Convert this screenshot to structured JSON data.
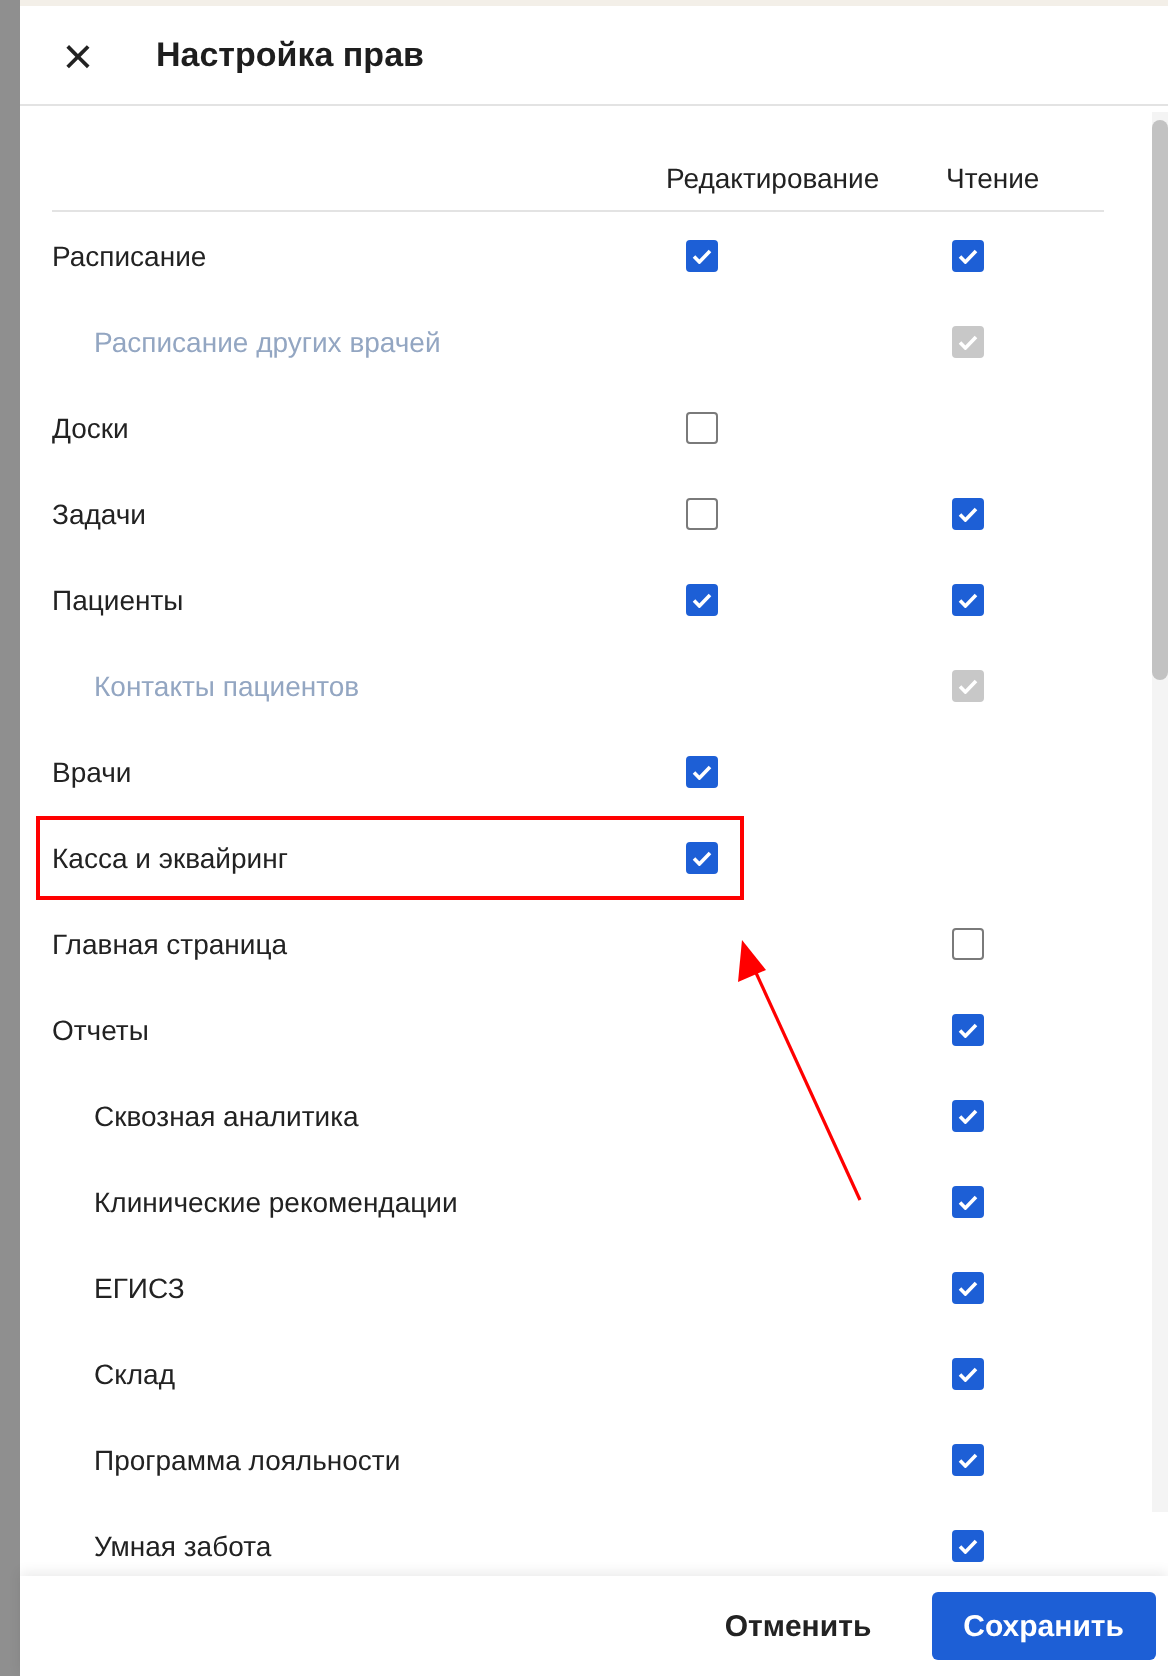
{
  "dialog": {
    "title": "Настройка прав",
    "close_icon": "×"
  },
  "columns": [
    "Редактирование",
    "Чтение"
  ],
  "rows": [
    {
      "label": "Расписание",
      "disabled": false,
      "edit": {
        "checked": true,
        "disabled": false
      },
      "read": {
        "checked": true,
        "disabled": false
      },
      "children": [
        {
          "label": "Расписание других врачей",
          "disabled": true,
          "read": {
            "checked": true,
            "disabled": true
          }
        }
      ]
    },
    {
      "label": "Доски",
      "disabled": false,
      "edit": {
        "checked": false,
        "disabled": false
      }
    },
    {
      "label": "Задачи",
      "disabled": false,
      "edit": {
        "checked": false,
        "disabled": false
      },
      "read": {
        "checked": true,
        "disabled": false
      }
    },
    {
      "label": "Пациенты",
      "disabled": false,
      "edit": {
        "checked": true,
        "disabled": false
      },
      "read": {
        "checked": true,
        "disabled": false
      },
      "children": [
        {
          "label": "Контакты пациентов",
          "disabled": true,
          "read": {
            "checked": true,
            "disabled": true
          }
        }
      ]
    },
    {
      "label": "Врачи",
      "disabled": false,
      "edit": {
        "checked": true,
        "disabled": false
      }
    },
    {
      "label": "Касса и эквайринг",
      "disabled": false,
      "highlighted": true,
      "edit": {
        "checked": true,
        "disabled": false
      }
    },
    {
      "label": "Главная страница",
      "disabled": false,
      "read": {
        "checked": false,
        "disabled": false
      }
    },
    {
      "label": "Отчеты",
      "disabled": false,
      "read": {
        "checked": true,
        "disabled": false
      },
      "children": [
        {
          "label": "Сквозная аналитика",
          "disabled": false,
          "read": {
            "checked": true,
            "disabled": false
          }
        },
        {
          "label": "Клинические рекомендации",
          "disabled": false,
          "read": {
            "checked": true,
            "disabled": false
          }
        },
        {
          "label": "ЕГИСЗ",
          "disabled": false,
          "read": {
            "checked": true,
            "disabled": false
          }
        },
        {
          "label": "Склад",
          "disabled": false,
          "read": {
            "checked": true,
            "disabled": false
          }
        },
        {
          "label": "Программа лояльности",
          "disabled": false,
          "read": {
            "checked": true,
            "disabled": false
          }
        },
        {
          "label": "Умная забота",
          "disabled": false,
          "read": {
            "checked": true,
            "disabled": false
          }
        }
      ]
    }
  ],
  "buttons": [
    {
      "label": "Отменить",
      "kind": "secondary"
    },
    {
      "label": "Сохранить",
      "kind": "primary"
    }
  ]
}
